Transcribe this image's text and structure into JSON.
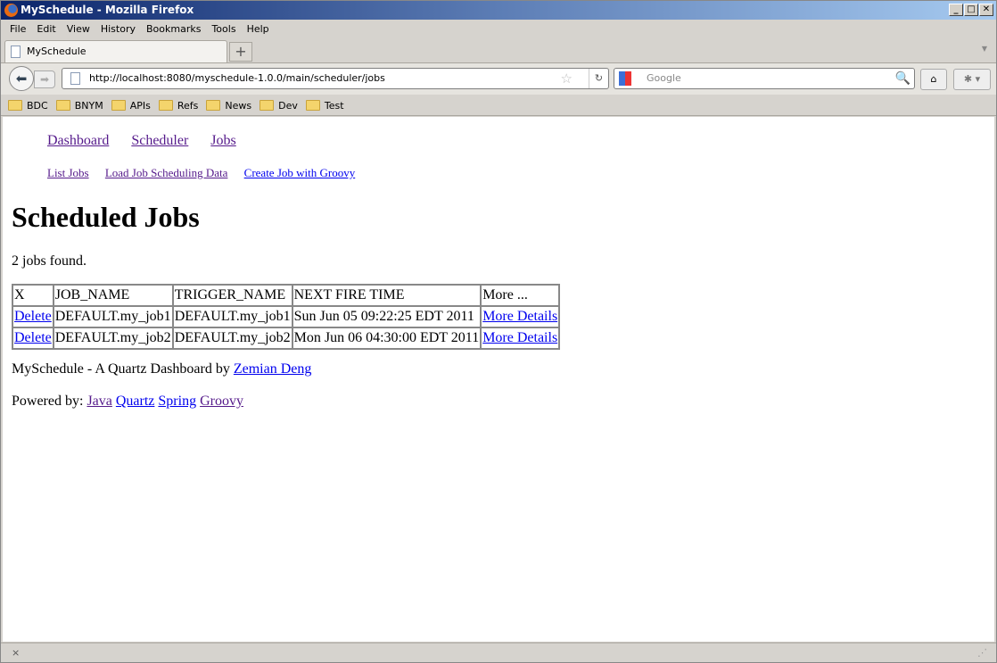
{
  "window": {
    "title": "MySchedule - Mozilla Firefox"
  },
  "menu": [
    "File",
    "Edit",
    "View",
    "History",
    "Bookmarks",
    "Tools",
    "Help"
  ],
  "tab": {
    "label": "MySchedule"
  },
  "urlbar": {
    "value": "http://localhost:8080/myschedule-1.0.0/main/scheduler/jobs"
  },
  "search": {
    "placeholder": "Google"
  },
  "bookmarks": [
    "BDC",
    "BNYM",
    "APIs",
    "Refs",
    "News",
    "Dev",
    "Test"
  ],
  "page": {
    "nav": [
      "Dashboard",
      "Scheduler",
      "Jobs"
    ],
    "subnav": [
      "List Jobs",
      "Load Job Scheduling Data",
      "Create Job with Groovy"
    ],
    "title": "Scheduled Jobs",
    "count": "2 jobs found.",
    "table": {
      "headers": [
        "X",
        "JOB_NAME",
        "TRIGGER_NAME",
        "NEXT FIRE TIME",
        "More ..."
      ],
      "rows": [
        {
          "action": "Delete",
          "job": "DEFAULT.my_job1",
          "trigger": "DEFAULT.my_job1",
          "next": "Sun Jun 05 09:22:25 EDT 2011",
          "more": "More Details"
        },
        {
          "action": "Delete",
          "job": "DEFAULT.my_job2",
          "trigger": "DEFAULT.my_job2",
          "next": "Mon Jun 06 04:30:00 EDT 2011",
          "more": "More Details"
        }
      ]
    },
    "footer": {
      "text": "MySchedule - A Quartz Dashboard by",
      "author": "Zemian Deng",
      "powered": "Powered by:",
      "tech": [
        "Java",
        "Quartz",
        "Spring",
        "Groovy"
      ]
    }
  },
  "status": {
    "close": "×"
  }
}
